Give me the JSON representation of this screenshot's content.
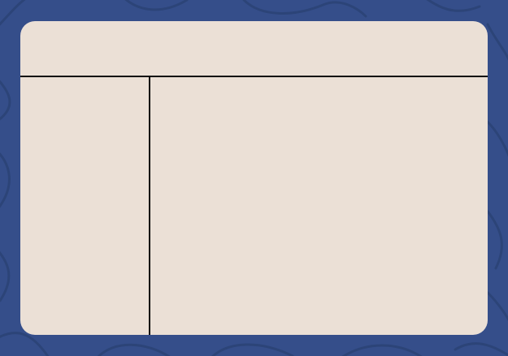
{
  "colors": {
    "background": "#354e8a",
    "pattern_line": "#2c4478",
    "card_fill": "#ebe0d6",
    "divider": "#0d0d0d"
  },
  "card": {
    "header_text": "",
    "sidebar_text": "",
    "content_text": ""
  }
}
